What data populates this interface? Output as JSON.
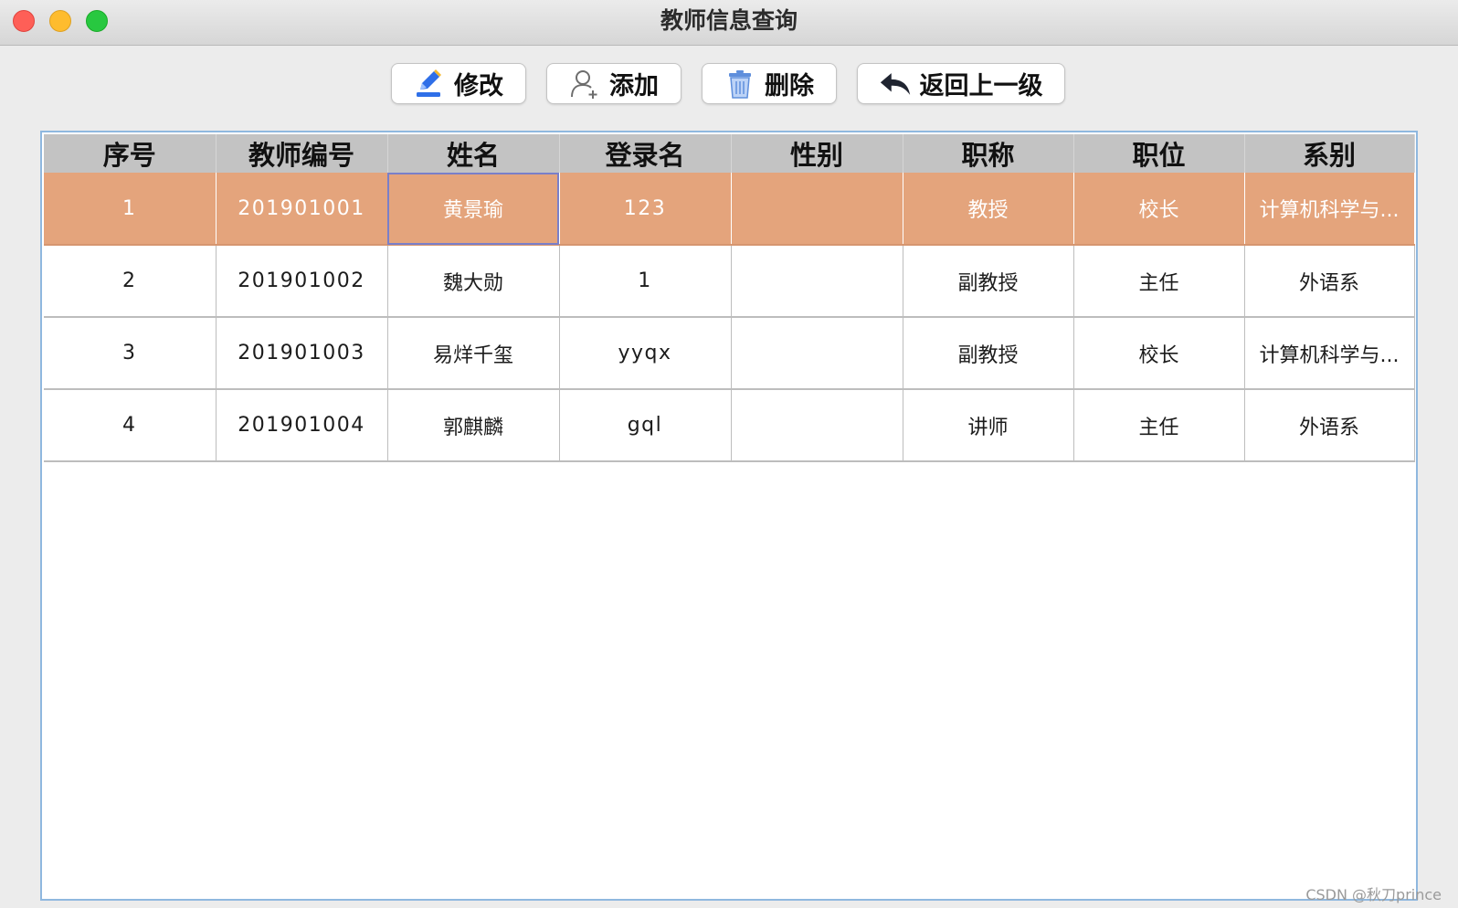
{
  "window": {
    "title": "教师信息查询"
  },
  "toolbar": {
    "edit_label": "修改",
    "add_label": "添加",
    "delete_label": "删除",
    "back_label": "返回上一级"
  },
  "table": {
    "columns": [
      "序号",
      "教师编号",
      "姓名",
      "登录名",
      "性别",
      "职称",
      "职位",
      "系别"
    ],
    "rows": [
      [
        "1",
        "201901001",
        "黄景瑜",
        "123",
        "",
        "教授",
        "校长",
        "计算机科学与..."
      ],
      [
        "2",
        "201901002",
        "魏大勋",
        "1",
        "",
        "副教授",
        "主任",
        "外语系"
      ],
      [
        "3",
        "201901003",
        "易烊千玺",
        "yyqx",
        "",
        "副教授",
        "校长",
        "计算机科学与..."
      ],
      [
        "4",
        "201901004",
        "郭麒麟",
        "gql",
        "",
        "讲师",
        "主任",
        "外语系"
      ]
    ],
    "selected_row": 0,
    "focused_cell": 2
  },
  "colors": {
    "selected_row": "#e4a47c",
    "header_bg": "#c3c3c3",
    "frame_border": "#8fb8df"
  },
  "watermark": "CSDN @秋刀prince"
}
